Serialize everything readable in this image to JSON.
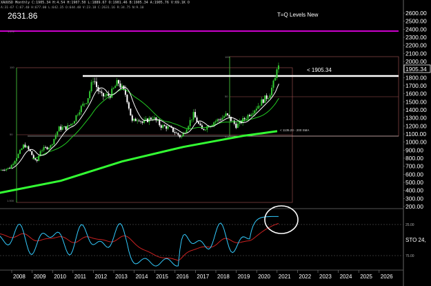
{
  "window": {
    "header_line": "XAUUSD Monthly C:1905.34 H:4.54 H:1907.50 L:1889.67 O:1901.46 B:1905.34 A:1905.76 V:69.1K O",
    "header_line2": "A:31-67 C:67.40 H:677.00 L:642.35 O:644.48 V:23.18 C:2631.16 R:34.75 N:9.10",
    "current_price": "2631.86",
    "chart_title": "T=Q Levels New",
    "price_annotation": "< 1905.34",
    "price_tag": "1905.34",
    "sma_label": "< 1135.23 - 200 SMA",
    "sto_label": "STO 24,",
    "fib_small_labels": [
      "1.272",
      "100",
      "50",
      "0.00",
      "100",
      "50",
      "0.00",
      "1.000"
    ],
    "rsi_levels": [
      "25.00",
      "75.00"
    ]
  },
  "colors": {
    "background": "#000000",
    "candle_up": "#33cc33",
    "candle_down": "#ffffff",
    "sma_green": "#33ff33",
    "ma_green": "#22cc22",
    "ma_white": "#ffffff",
    "magenta_line": "#cc00cc",
    "stoch_fast": "#33ccff",
    "stoch_slow": "#cc2222",
    "circle": "#ffffff"
  },
  "chart_data": {
    "type": "candlestick",
    "title": "T=Q Levels New",
    "y_axis_ticks": [
      200,
      300,
      400,
      500,
      600,
      700,
      800,
      900,
      1000,
      1100,
      1200,
      1300,
      1400,
      1500,
      1600,
      1700,
      1800,
      1900,
      2000,
      2100,
      2200,
      2300,
      2400,
      2500,
      2600
    ],
    "ylim": [
      200,
      2650
    ],
    "x_axis_ticks": [
      "2008",
      "2009",
      "2010",
      "2011",
      "2012",
      "2013",
      "2014",
      "2015",
      "2016",
      "2017",
      "2018",
      "2019",
      "2020",
      "2021",
      "2022",
      "2023",
      "2024",
      "2025",
      "2026"
    ],
    "price_path": [
      [
        2007.0,
        650
      ],
      [
        2007.5,
        680
      ],
      [
        2008.0,
        880
      ],
      [
        2008.2,
        970
      ],
      [
        2008.5,
        880
      ],
      [
        2008.8,
        740
      ],
      [
        2009.0,
        900
      ],
      [
        2009.5,
        950
      ],
      [
        2009.9,
        1170
      ],
      [
        2010.3,
        1180
      ],
      [
        2010.6,
        1250
      ],
      [
        2010.9,
        1400
      ],
      [
        2011.3,
        1530
      ],
      [
        2011.6,
        1800
      ],
      [
        2011.8,
        1650
      ],
      [
        2012.0,
        1570
      ],
      [
        2012.4,
        1580
      ],
      [
        2012.8,
        1750
      ],
      [
        2013.2,
        1580
      ],
      [
        2013.5,
        1250
      ],
      [
        2013.8,
        1300
      ],
      [
        2014.0,
        1240
      ],
      [
        2014.5,
        1310
      ],
      [
        2014.9,
        1200
      ],
      [
        2015.3,
        1180
      ],
      [
        2015.9,
        1060
      ],
      [
        2016.5,
        1340
      ],
      [
        2016.9,
        1150
      ],
      [
        2017.5,
        1250
      ],
      [
        2017.9,
        1300
      ],
      [
        2018.1,
        1340
      ],
      [
        2018.6,
        1200
      ],
      [
        2019.0,
        1290
      ],
      [
        2019.5,
        1410
      ],
      [
        2019.9,
        1520
      ],
      [
        2020.2,
        1580
      ],
      [
        2020.5,
        1780
      ],
      [
        2020.6,
        1970
      ],
      [
        2020.7,
        1905
      ]
    ],
    "series": [
      {
        "name": "200 SMA",
        "points": [
          [
            2007.0,
            370
          ],
          [
            2010.0,
            520
          ],
          [
            2013.0,
            760
          ],
          [
            2016.0,
            940
          ],
          [
            2019.0,
            1080
          ],
          [
            2020.6,
            1135
          ]
        ]
      }
    ],
    "horizontal_levels": [
      2380,
      1800,
      1560,
      1080,
      260
    ],
    "price_annotation": 1905.34,
    "sma_value": 1135.23
  }
}
